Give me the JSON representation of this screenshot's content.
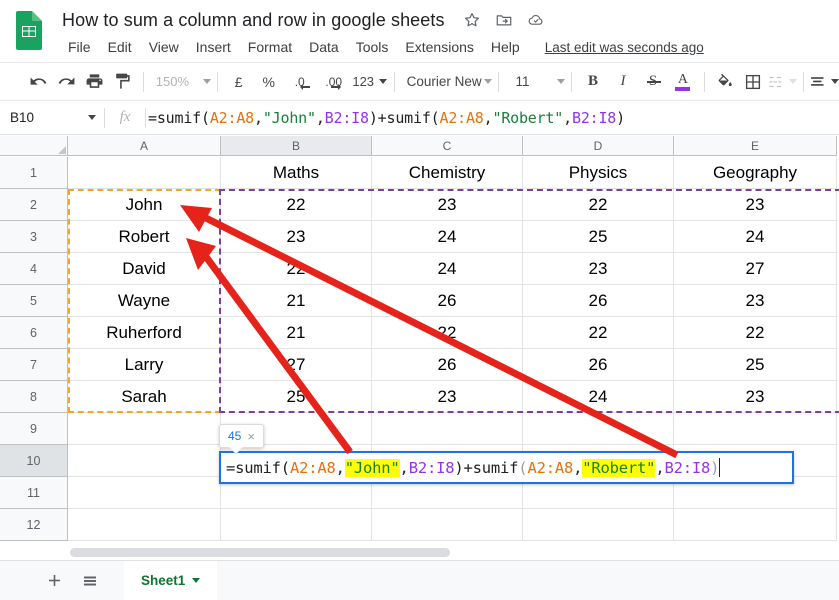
{
  "app": {
    "doc_title": "How to sum a column and row in google sheets",
    "last_edit": "Last edit was seconds ago",
    "title_icons": [
      "star-icon",
      "move-to-folder-icon",
      "cloud-saved-icon"
    ]
  },
  "menu": {
    "items": [
      "File",
      "Edit",
      "View",
      "Insert",
      "Format",
      "Data",
      "Tools",
      "Extensions",
      "Help"
    ]
  },
  "toolbar": {
    "undo": "undo-icon",
    "redo": "redo-icon",
    "print": "print-icon",
    "paint": "paint-format-icon",
    "zoom_value": "150%",
    "currency": "£",
    "percent": "%",
    "decrease_decimal": ".0",
    "increase_decimal": ".00",
    "number_format": "123",
    "font_family": "Courier New",
    "font_size": "11",
    "bold": "B",
    "italic": "I",
    "strikethrough": "S",
    "text_color": "A",
    "text_color_swatch": "#9334e6",
    "fill_color": "fill-color-icon",
    "borders": "borders-icon",
    "merge_cells": "merge-cells-icon",
    "align": "align-icon"
  },
  "formula_bar": {
    "name_box": "B10",
    "fx_label": "fx",
    "formula_segments": [
      {
        "text": "=sumif(",
        "color": "default"
      },
      {
        "text": "A2:A8",
        "color": "orange"
      },
      {
        "text": ",",
        "color": "default"
      },
      {
        "text": "\"John\"",
        "color": "green"
      },
      {
        "text": ",",
        "color": "default"
      },
      {
        "text": "B2:I8",
        "color": "purple"
      },
      {
        "text": ")+sumif(",
        "color": "default"
      },
      {
        "text": "A2:A8",
        "color": "orange"
      },
      {
        "text": ",",
        "color": "default"
      },
      {
        "text": "\"Robert\"",
        "color": "green"
      },
      {
        "text": ",",
        "color": "default"
      },
      {
        "text": "B2:I8",
        "color": "purple"
      },
      {
        "text": ")",
        "color": "default"
      }
    ],
    "formula_plain": "=sumif(A2:A8,\"John\",B2:I8)+sumif(A2:A8,\"Robert\",B2:I8)"
  },
  "grid": {
    "column_headers": [
      "A",
      "B",
      "C",
      "D",
      "E"
    ],
    "active_column": "B",
    "row_headers": [
      "1",
      "2",
      "3",
      "4",
      "5",
      "6",
      "7",
      "8",
      "9",
      "10",
      "11",
      "12"
    ],
    "active_row": "10",
    "rows": [
      {
        "num": "1",
        "cells": [
          "",
          "Maths",
          "Chemistry",
          "Physics",
          "Geography"
        ]
      },
      {
        "num": "2",
        "cells": [
          "John",
          "22",
          "23",
          "22",
          "23"
        ]
      },
      {
        "num": "3",
        "cells": [
          "Robert",
          "23",
          "24",
          "25",
          "24"
        ]
      },
      {
        "num": "4",
        "cells": [
          "David",
          "22",
          "24",
          "23",
          "27"
        ]
      },
      {
        "num": "5",
        "cells": [
          "Wayne",
          "21",
          "26",
          "26",
          "23"
        ]
      },
      {
        "num": "6",
        "cells": [
          "Ruherford",
          "21",
          "22",
          "22",
          "22"
        ]
      },
      {
        "num": "7",
        "cells": [
          "Larry",
          "27",
          "26",
          "26",
          "25"
        ]
      },
      {
        "num": "8",
        "cells": [
          "Sarah",
          "25",
          "23",
          "24",
          "23"
        ]
      },
      {
        "num": "9",
        "cells": [
          "",
          "",
          "",
          "",
          ""
        ]
      },
      {
        "num": "10",
        "cells": [
          "",
          "",
          "",
          "",
          ""
        ]
      },
      {
        "num": "11",
        "cells": [
          "",
          "",
          "",
          "",
          ""
        ]
      },
      {
        "num": "12",
        "cells": [
          "",
          "",
          "",
          "",
          ""
        ]
      }
    ]
  },
  "cell_editor": {
    "target_cell": "B10",
    "segments": [
      {
        "text": "=sumif(",
        "color": "default",
        "highlight": false
      },
      {
        "text": "A2:A8",
        "color": "orange",
        "highlight": false
      },
      {
        "text": ",",
        "color": "default",
        "highlight": false
      },
      {
        "text": "\"John\"",
        "color": "green",
        "highlight": true
      },
      {
        "text": ",",
        "color": "default",
        "highlight": false
      },
      {
        "text": "B2:I8",
        "color": "purple",
        "highlight": false
      },
      {
        "text": ")+sumif",
        "color": "default",
        "highlight": false
      },
      {
        "text": "(",
        "color": "gray",
        "highlight": false
      },
      {
        "text": "A2:A8",
        "color": "orange",
        "highlight": false
      },
      {
        "text": ",",
        "color": "default",
        "highlight": false
      },
      {
        "text": "\"Robert\"",
        "color": "green",
        "highlight": true
      },
      {
        "text": ",",
        "color": "default",
        "highlight": false
      },
      {
        "text": "B2:I8",
        "color": "purple",
        "highlight": false
      },
      {
        "text": ")",
        "color": "gray",
        "highlight": false
      }
    ]
  },
  "result_tooltip": {
    "value": "45",
    "close": "×"
  },
  "range_highlights": {
    "criteria_range": {
      "label": "A2:A8",
      "color": "#f5a623"
    },
    "sum_range": {
      "label": "B2:I8",
      "color": "#7b3fa0"
    }
  },
  "annotations": {
    "arrow_color": "#e5231b",
    "arrows": [
      {
        "name": "arrow-to-john",
        "target": "John"
      },
      {
        "name": "arrow-to-robert",
        "target": "Robert"
      }
    ]
  },
  "sheet_bar": {
    "add_sheet": "+",
    "all_sheets": "all-sheets-icon",
    "tabs": [
      {
        "label": "Sheet1",
        "active": true
      }
    ]
  }
}
